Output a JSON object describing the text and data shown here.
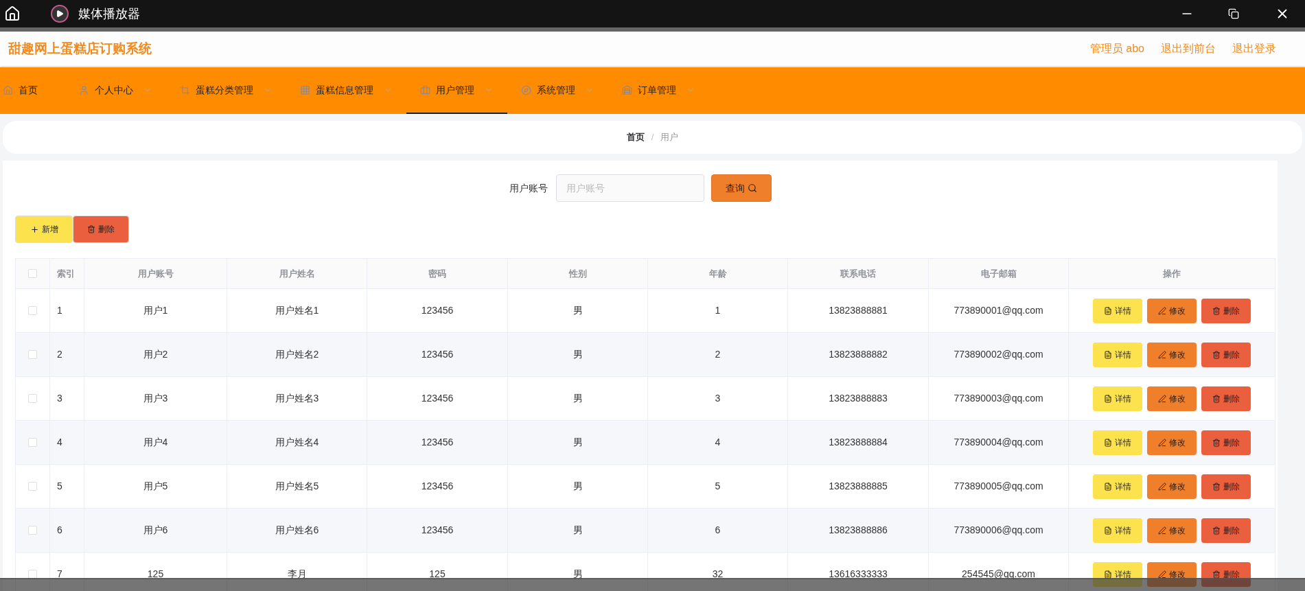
{
  "window": {
    "title": "媒体播放器"
  },
  "header": {
    "site_title": "甜趣网上蛋糕店订购系统",
    "links": [
      "管理员 abo",
      "退出到前台",
      "退出登录"
    ]
  },
  "nav": [
    {
      "label": "首页",
      "dropdown": false,
      "selected": false
    },
    {
      "label": "个人中心",
      "dropdown": true,
      "selected": false
    },
    {
      "label": "蛋糕分类管理",
      "dropdown": true,
      "selected": false
    },
    {
      "label": "蛋糕信息管理",
      "dropdown": true,
      "selected": false
    },
    {
      "label": "用户管理",
      "dropdown": true,
      "selected": true
    },
    {
      "label": "系统管理",
      "dropdown": true,
      "selected": false
    },
    {
      "label": "订单管理",
      "dropdown": true,
      "selected": false
    }
  ],
  "breadcrumb": {
    "items": [
      "首页",
      "用户"
    ],
    "separator": "/"
  },
  "search": {
    "label": "用户账号",
    "placeholder": "用户账号",
    "button": "查询"
  },
  "actions": {
    "add": "新增",
    "delete": "删除"
  },
  "table": {
    "select_all_checked": false,
    "columns": [
      "索引",
      "用户账号",
      "用户姓名",
      "密码",
      "性别",
      "年龄",
      "联系电话",
      "电子邮箱",
      "操作"
    ],
    "rows": [
      {
        "checked": false,
        "cells": [
          "1",
          "用户1",
          "用户姓名1",
          "123456",
          "男",
          "1",
          "13823888881",
          "773890001@qq.com"
        ],
        "buttons": [
          "详情",
          "修改",
          "删除"
        ]
      },
      {
        "checked": false,
        "cells": [
          "2",
          "用户2",
          "用户姓名2",
          "123456",
          "男",
          "2",
          "13823888882",
          "773890002@qq.com"
        ],
        "buttons": [
          "详情",
          "修改",
          "删除"
        ]
      },
      {
        "checked": false,
        "cells": [
          "3",
          "用户3",
          "用户姓名3",
          "123456",
          "男",
          "3",
          "13823888883",
          "773890003@qq.com"
        ],
        "buttons": [
          "详情",
          "修改",
          "删除"
        ]
      },
      {
        "checked": false,
        "cells": [
          "4",
          "用户4",
          "用户姓名4",
          "123456",
          "男",
          "4",
          "13823888884",
          "773890004@qq.com"
        ],
        "buttons": [
          "详情",
          "修改",
          "删除"
        ]
      },
      {
        "checked": false,
        "cells": [
          "5",
          "用户5",
          "用户姓名5",
          "123456",
          "男",
          "5",
          "13823888885",
          "773890005@qq.com"
        ],
        "buttons": [
          "详情",
          "修改",
          "删除"
        ]
      },
      {
        "checked": false,
        "cells": [
          "6",
          "用户6",
          "用户姓名6",
          "123456",
          "男",
          "6",
          "13823888886",
          "773890006@qq.com"
        ],
        "buttons": [
          "详情",
          "修改",
          "删除"
        ]
      },
      {
        "checked": false,
        "cells": [
          "7",
          "125",
          "李月",
          "125",
          "男",
          "32",
          "13616333333",
          "254545@qq.com"
        ],
        "buttons": [
          "详情",
          "修改",
          "删除"
        ]
      }
    ]
  }
}
